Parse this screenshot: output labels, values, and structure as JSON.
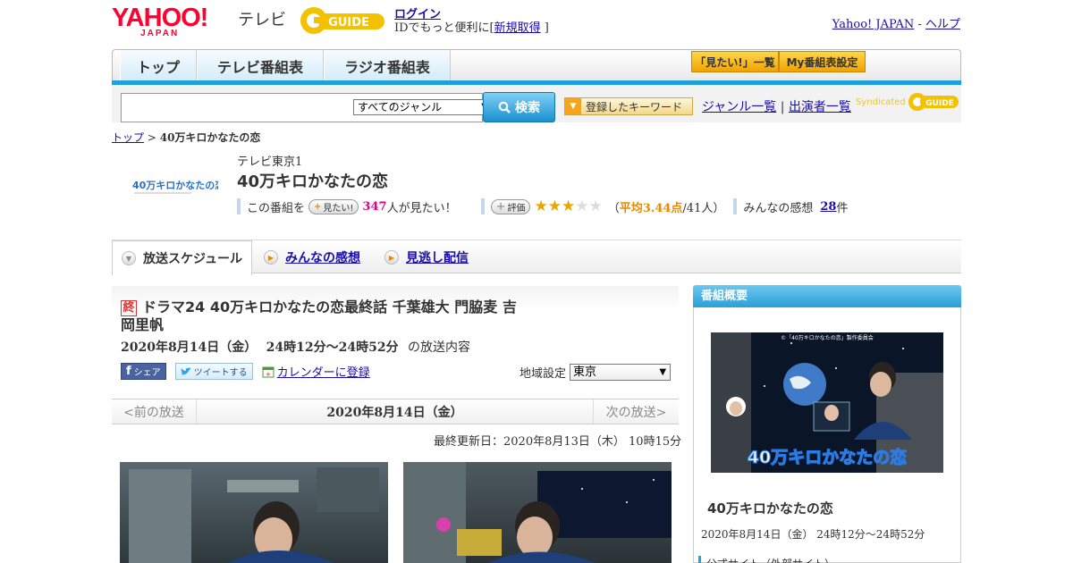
{
  "header": {
    "yahoo_logo": "YAHOO!",
    "yahoo_logo_sub": "JAPAN",
    "tv_label": "テレビ",
    "gguide_logo": "G-GUIDE",
    "login": "ログイン",
    "login_prompt": "IDでもっと便利に[",
    "register": "新規取得",
    "login_prompt_end": "]",
    "yahoo_japan_link": "Yahoo! JAPAN",
    "separator": "-",
    "help_link": "ヘルプ"
  },
  "nav": {
    "tabs": [
      "トップ",
      "テレビ番組表",
      "ラジオ番組表"
    ],
    "want_list": "「見たい!」一覧",
    "my_schedule": "My番組表設定"
  },
  "search": {
    "genre_selected": "すべてのジャンル",
    "search_button": "検索",
    "keyword_button": "登録したキーワード",
    "genre_list": "ジャンル一覧",
    "divider": "|",
    "performer_list": "出演者一覧",
    "syndicated": "Syndicated"
  },
  "breadcrumb": {
    "top": "トップ",
    "sep": ">",
    "current": "40万キロかなたの恋"
  },
  "program": {
    "channel": "テレビ東京1",
    "title": "40万キロかなたの恋",
    "logo_text": "40万キロかなたの恋",
    "this_program": "この番組を",
    "want_button": "見たい!",
    "want_count": "347",
    "want_suffix": "人が見たい！",
    "rate_button": "評価",
    "rating_open": "（",
    "rating_avg": "平均3.44点",
    "rating_votes": "/41人）",
    "impressions_label": "みんなの感想",
    "impressions_count": "28",
    "impressions_suffix": "件",
    "rating_value": 3.44,
    "rating_max": 5
  },
  "schedule_tabs": {
    "broadcast": "放送スケジュール",
    "impressions": "みんなの感想",
    "missed": "見逃し配信"
  },
  "episode": {
    "end_badge": "終",
    "title": "ドラマ24 40万キロかなたの恋最終話 千葉雄大 門脇麦 吉岡里帆",
    "date": "2020年8月14日（金）",
    "time": "24時12分～24時52分",
    "date_suffix": "の放送内容",
    "fb_share": "シェア",
    "tweet": "ツイートする",
    "calendar": "カレンダーに登録",
    "region_label": "地域設定",
    "region_value": "東京"
  },
  "date_nav": {
    "prev": "<前の放送",
    "current": "2020年8月14日（金）",
    "next": "次の放送>"
  },
  "last_update": "最終更新日：2020年8月13日（木） 10時15分",
  "sidebar": {
    "heading": "番組概要",
    "image_title": "40万キロかなたの恋",
    "image_credit": "©「40万キロかなたの恋」製作委員会",
    "title": "40万キロかなたの恋",
    "date": "2020年8月14日（金） 24時12分～24時52分",
    "official": "公式サイト（外部サイト）"
  },
  "colors": {
    "brand_red": "#ff0033",
    "accent_blue": "#1fa0dc",
    "want_pink": "#e4007f",
    "rating_orange": "#e88a00"
  }
}
